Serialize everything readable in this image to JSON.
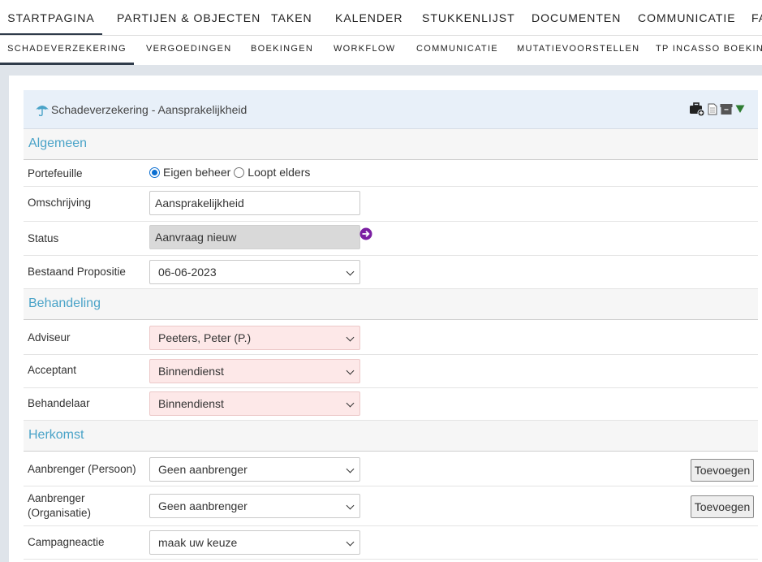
{
  "top_nav": {
    "items": [
      {
        "label": "STARTPAGINA",
        "active": true
      },
      {
        "label": "PARTIJEN & OBJECTEN"
      },
      {
        "label": "TAKEN"
      },
      {
        "label": "KALENDER"
      },
      {
        "label": "STUKKENLIJST"
      },
      {
        "label": "DOCUMENTEN"
      },
      {
        "label": "COMMUNICATIE"
      },
      {
        "label": "FA"
      }
    ]
  },
  "sub_nav": {
    "items": [
      {
        "label": "SCHADEVERZEKERING",
        "active": true
      },
      {
        "label": "VERGOEDINGEN"
      },
      {
        "label": "BOEKINGEN"
      },
      {
        "label": "WORKFLOW"
      },
      {
        "label": "COMMUNICATIE"
      },
      {
        "label": "MUTATIEVOORSTELLEN"
      },
      {
        "label": "TP INCASSO BOEKING"
      }
    ]
  },
  "card": {
    "title": "Schadeverzekering - Aansprakelijkheid",
    "icon": "umbrella-icon",
    "tools": [
      "briefcase-add-icon",
      "document-icon",
      "archive-icon",
      "caret-down-icon"
    ]
  },
  "sections": {
    "algemeen": "Algemeen",
    "behandeling": "Behandeling",
    "herkomst": "Herkomst"
  },
  "form": {
    "portefeuille": {
      "label": "Portefeuille",
      "options": [
        "Eigen beheer",
        "Loopt elders"
      ],
      "selected": "Eigen beheer"
    },
    "omschrijving": {
      "label": "Omschrijving",
      "value": "Aansprakelijkheid"
    },
    "status": {
      "label": "Status",
      "value": "Aanvraag nieuw"
    },
    "bestaand_propositie": {
      "label": "Bestaand Propositie",
      "value": "06-06-2023"
    },
    "adviseur": {
      "label": "Adviseur",
      "value": "Peeters, Peter (P.)"
    },
    "acceptant": {
      "label": "Acceptant",
      "value": "Binnendienst"
    },
    "behandelaar": {
      "label": "Behandelaar",
      "value": "Binnendienst"
    },
    "aanbrenger_persoon": {
      "label": "Aanbrenger (Persoon)",
      "value": "Geen aanbrenger",
      "button": "Toevoegen"
    },
    "aanbrenger_organisatie": {
      "label_line1": "Aanbrenger",
      "label_line2": "(Organisatie)",
      "value": "Geen aanbrenger",
      "button": "Toevoegen"
    },
    "campagneactie": {
      "label": "Campagneactie",
      "value": "maak uw keuze"
    }
  },
  "colors": {
    "accent": "#4aa3c8",
    "required_bg": "#fde8e8",
    "header_bg": "#e8f0f9",
    "status_arrow": "#7b1fa2",
    "archive_arrow": "#2e7d32"
  }
}
